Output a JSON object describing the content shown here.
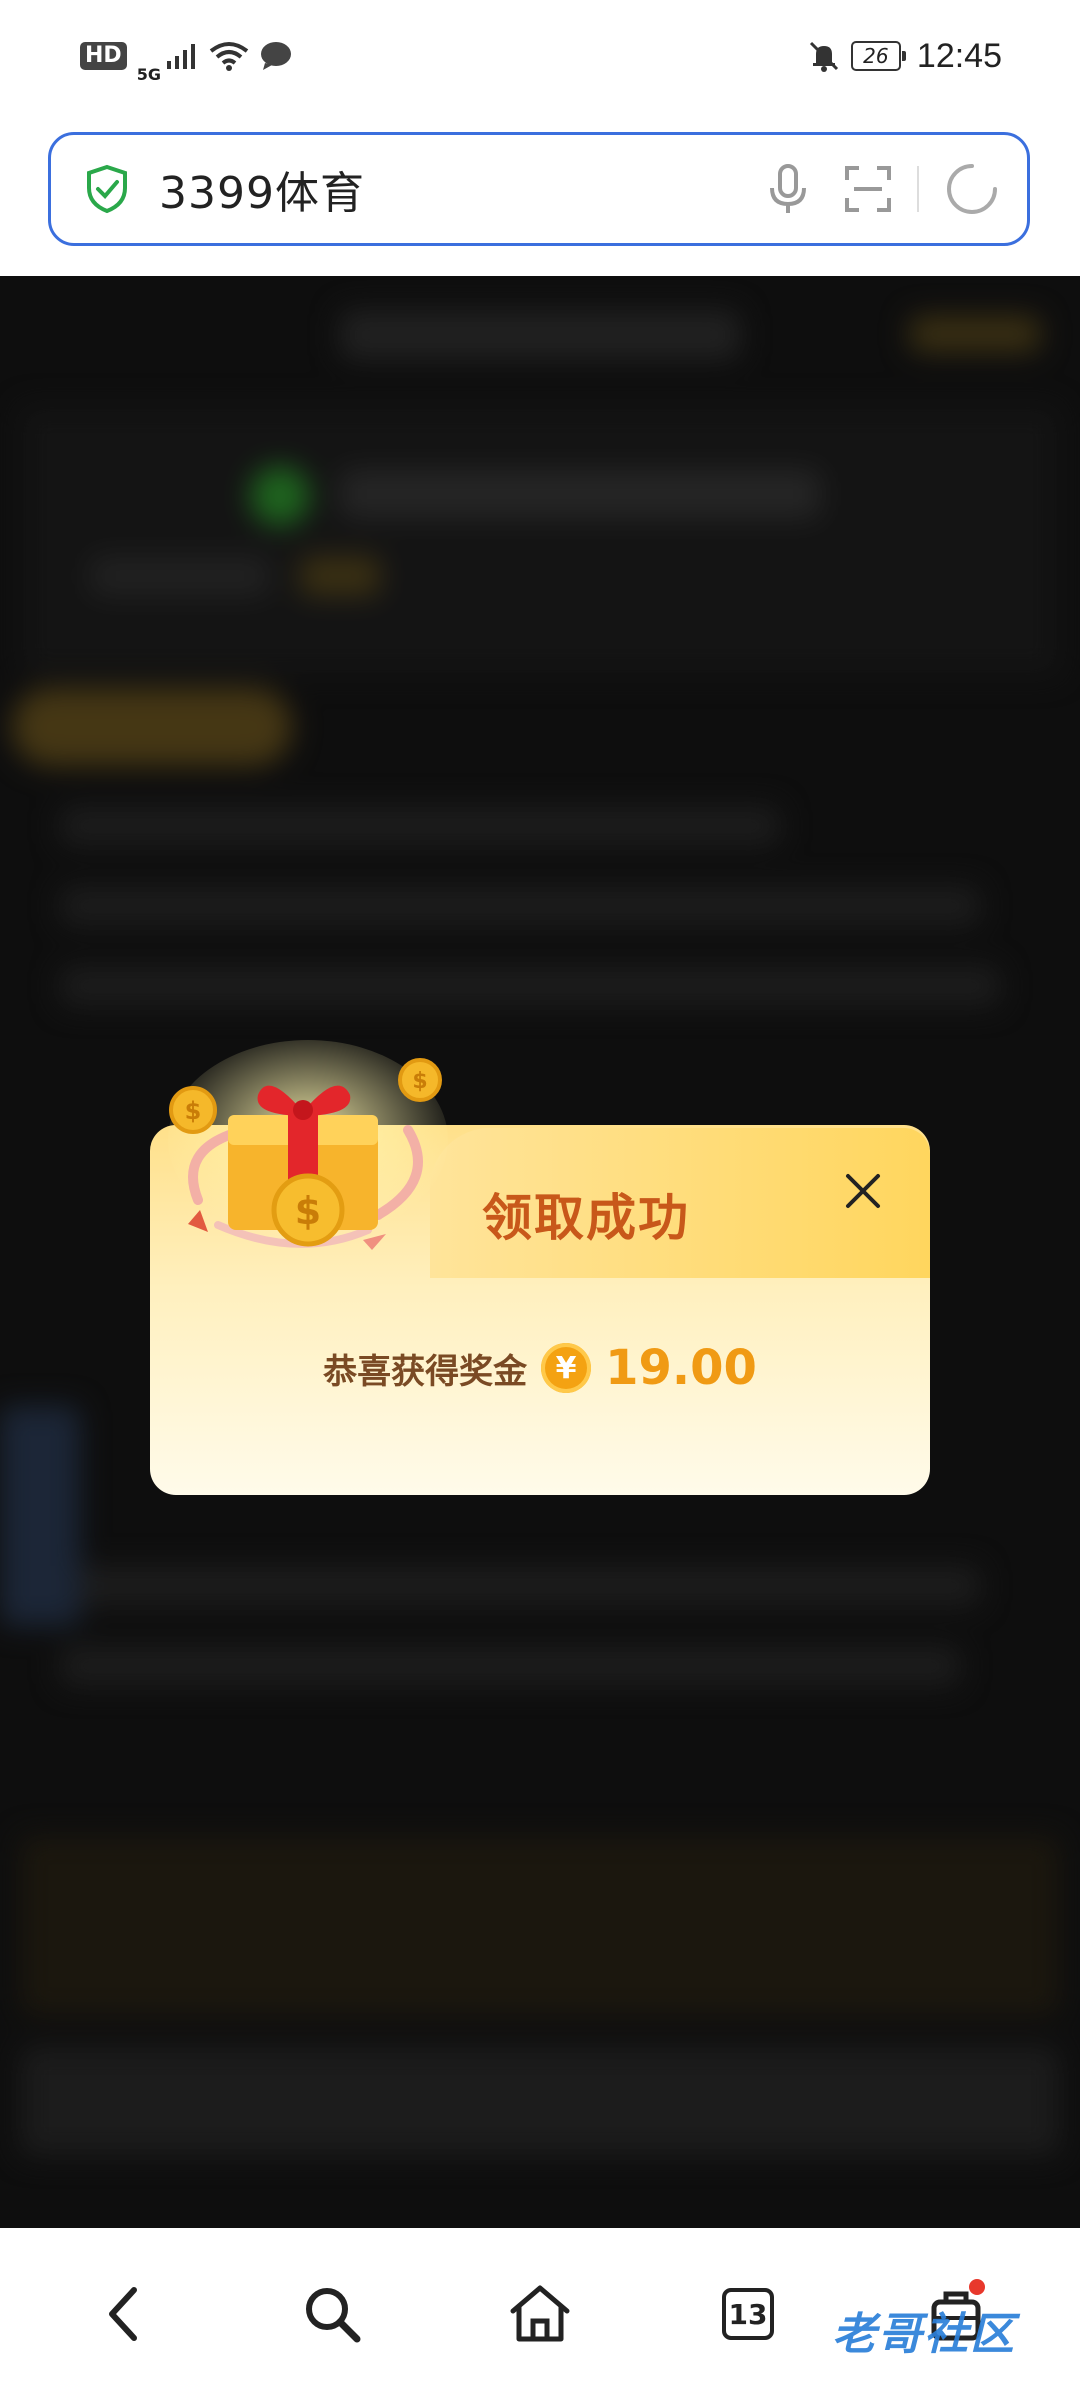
{
  "status_bar": {
    "hd": "HD",
    "network": "5G",
    "battery": "26",
    "time": "12:45"
  },
  "address_bar": {
    "text": "3399体育"
  },
  "popup": {
    "title": "领取成功",
    "message": "恭喜获得奖金",
    "currency_symbol": "¥",
    "amount": "19.00"
  },
  "bottom_nav": {
    "tab_count": "13"
  },
  "watermark": "老哥社区",
  "colors": {
    "accent_blue": "#3b6fde",
    "popup_title": "#c8581a",
    "amount": "#f09a14"
  }
}
